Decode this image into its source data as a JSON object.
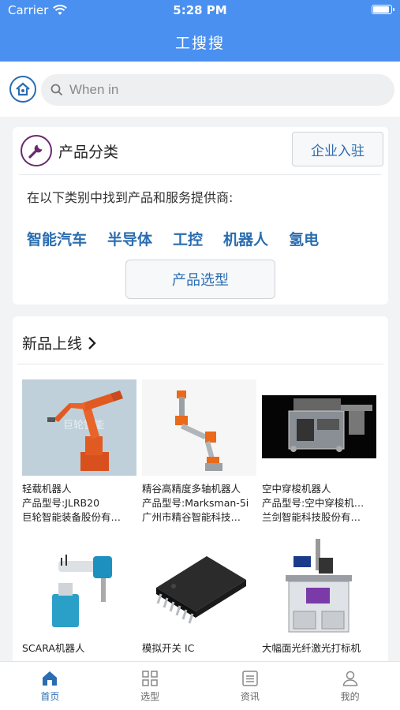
{
  "status_bar": {
    "carrier": "Carrier",
    "time": "5:28 PM"
  },
  "header": {
    "title": "工搜搜"
  },
  "search": {
    "placeholder": "When in"
  },
  "categories": {
    "title": "产品分类",
    "join_button": "企业入驻",
    "description": "在以下类别中找到产品和服务提供商:",
    "links": [
      "智能汽车",
      "半导体",
      "工控",
      "机器人",
      "氢电"
    ],
    "select_button": "产品选型"
  },
  "new_products": {
    "title": "新品上线",
    "items": [
      {
        "name": "轻载机器人",
        "model": "产品型号:JLRB20",
        "company": "巨轮智能装备股份有…"
      },
      {
        "name": "精谷高精度多轴机器人",
        "model": "产品型号:Marksman-5i",
        "company": "广州市精谷智能科技…"
      },
      {
        "name": "空中穿梭机器人",
        "model": "产品型号:空中穿梭机…",
        "company": "兰剑智能科技股份有…"
      },
      {
        "name": "SCARA机器人",
        "model": "",
        "company": ""
      },
      {
        "name": "模拟开关 IC",
        "model": "",
        "company": ""
      },
      {
        "name": "大幅面光纤激光打标机",
        "model": "",
        "company": ""
      }
    ]
  },
  "tabbar": [
    {
      "label": "首页",
      "icon": "home-icon",
      "active": true
    },
    {
      "label": "选型",
      "icon": "grid-icon",
      "active": false
    },
    {
      "label": "资讯",
      "icon": "news-icon",
      "active": false
    },
    {
      "label": "我的",
      "icon": "user-icon",
      "active": false
    }
  ],
  "colors": {
    "primary": "#4a90f0",
    "link": "#2a6db0",
    "background": "#f2f3f5"
  }
}
